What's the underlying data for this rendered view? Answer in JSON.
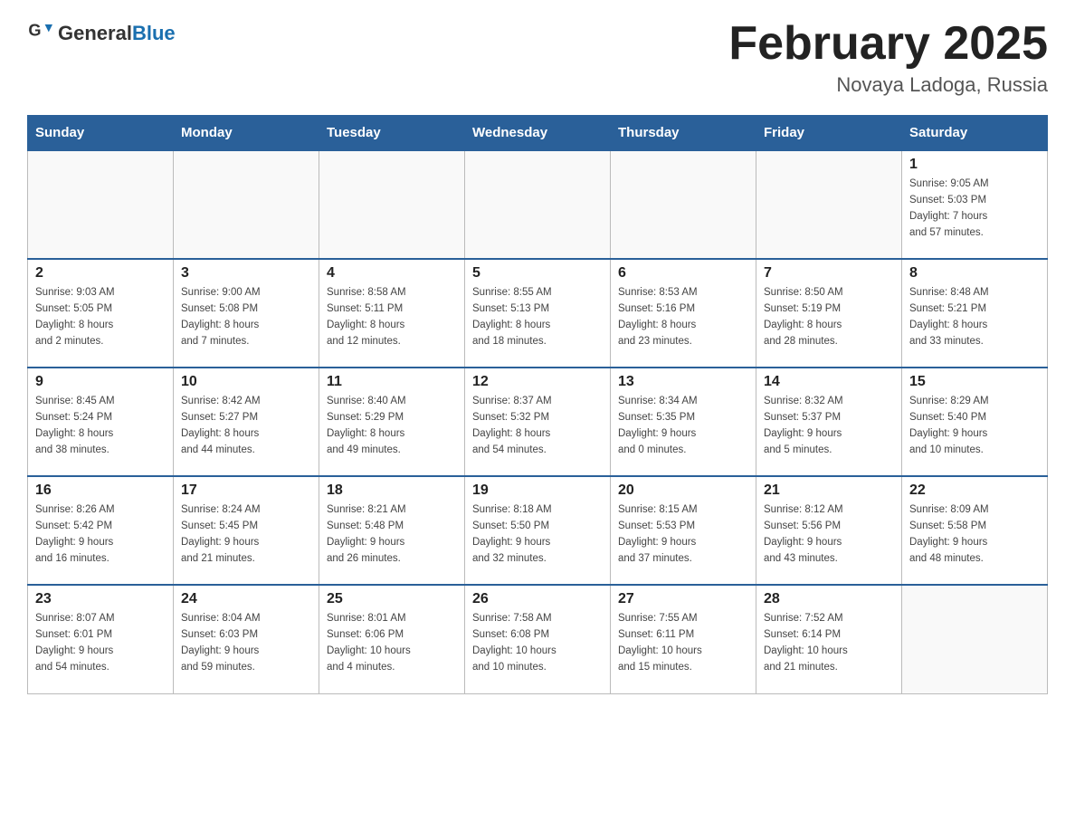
{
  "header": {
    "logo_general": "General",
    "logo_blue": "Blue",
    "month_title": "February 2025",
    "location": "Novaya Ladoga, Russia"
  },
  "days_of_week": [
    "Sunday",
    "Monday",
    "Tuesday",
    "Wednesday",
    "Thursday",
    "Friday",
    "Saturday"
  ],
  "weeks": [
    [
      {
        "day": "",
        "info": ""
      },
      {
        "day": "",
        "info": ""
      },
      {
        "day": "",
        "info": ""
      },
      {
        "day": "",
        "info": ""
      },
      {
        "day": "",
        "info": ""
      },
      {
        "day": "",
        "info": ""
      },
      {
        "day": "1",
        "info": "Sunrise: 9:05 AM\nSunset: 5:03 PM\nDaylight: 7 hours\nand 57 minutes."
      }
    ],
    [
      {
        "day": "2",
        "info": "Sunrise: 9:03 AM\nSunset: 5:05 PM\nDaylight: 8 hours\nand 2 minutes."
      },
      {
        "day": "3",
        "info": "Sunrise: 9:00 AM\nSunset: 5:08 PM\nDaylight: 8 hours\nand 7 minutes."
      },
      {
        "day": "4",
        "info": "Sunrise: 8:58 AM\nSunset: 5:11 PM\nDaylight: 8 hours\nand 12 minutes."
      },
      {
        "day": "5",
        "info": "Sunrise: 8:55 AM\nSunset: 5:13 PM\nDaylight: 8 hours\nand 18 minutes."
      },
      {
        "day": "6",
        "info": "Sunrise: 8:53 AM\nSunset: 5:16 PM\nDaylight: 8 hours\nand 23 minutes."
      },
      {
        "day": "7",
        "info": "Sunrise: 8:50 AM\nSunset: 5:19 PM\nDaylight: 8 hours\nand 28 minutes."
      },
      {
        "day": "8",
        "info": "Sunrise: 8:48 AM\nSunset: 5:21 PM\nDaylight: 8 hours\nand 33 minutes."
      }
    ],
    [
      {
        "day": "9",
        "info": "Sunrise: 8:45 AM\nSunset: 5:24 PM\nDaylight: 8 hours\nand 38 minutes."
      },
      {
        "day": "10",
        "info": "Sunrise: 8:42 AM\nSunset: 5:27 PM\nDaylight: 8 hours\nand 44 minutes."
      },
      {
        "day": "11",
        "info": "Sunrise: 8:40 AM\nSunset: 5:29 PM\nDaylight: 8 hours\nand 49 minutes."
      },
      {
        "day": "12",
        "info": "Sunrise: 8:37 AM\nSunset: 5:32 PM\nDaylight: 8 hours\nand 54 minutes."
      },
      {
        "day": "13",
        "info": "Sunrise: 8:34 AM\nSunset: 5:35 PM\nDaylight: 9 hours\nand 0 minutes."
      },
      {
        "day": "14",
        "info": "Sunrise: 8:32 AM\nSunset: 5:37 PM\nDaylight: 9 hours\nand 5 minutes."
      },
      {
        "day": "15",
        "info": "Sunrise: 8:29 AM\nSunset: 5:40 PM\nDaylight: 9 hours\nand 10 minutes."
      }
    ],
    [
      {
        "day": "16",
        "info": "Sunrise: 8:26 AM\nSunset: 5:42 PM\nDaylight: 9 hours\nand 16 minutes."
      },
      {
        "day": "17",
        "info": "Sunrise: 8:24 AM\nSunset: 5:45 PM\nDaylight: 9 hours\nand 21 minutes."
      },
      {
        "day": "18",
        "info": "Sunrise: 8:21 AM\nSunset: 5:48 PM\nDaylight: 9 hours\nand 26 minutes."
      },
      {
        "day": "19",
        "info": "Sunrise: 8:18 AM\nSunset: 5:50 PM\nDaylight: 9 hours\nand 32 minutes."
      },
      {
        "day": "20",
        "info": "Sunrise: 8:15 AM\nSunset: 5:53 PM\nDaylight: 9 hours\nand 37 minutes."
      },
      {
        "day": "21",
        "info": "Sunrise: 8:12 AM\nSunset: 5:56 PM\nDaylight: 9 hours\nand 43 minutes."
      },
      {
        "day": "22",
        "info": "Sunrise: 8:09 AM\nSunset: 5:58 PM\nDaylight: 9 hours\nand 48 minutes."
      }
    ],
    [
      {
        "day": "23",
        "info": "Sunrise: 8:07 AM\nSunset: 6:01 PM\nDaylight: 9 hours\nand 54 minutes."
      },
      {
        "day": "24",
        "info": "Sunrise: 8:04 AM\nSunset: 6:03 PM\nDaylight: 9 hours\nand 59 minutes."
      },
      {
        "day": "25",
        "info": "Sunrise: 8:01 AM\nSunset: 6:06 PM\nDaylight: 10 hours\nand 4 minutes."
      },
      {
        "day": "26",
        "info": "Sunrise: 7:58 AM\nSunset: 6:08 PM\nDaylight: 10 hours\nand 10 minutes."
      },
      {
        "day": "27",
        "info": "Sunrise: 7:55 AM\nSunset: 6:11 PM\nDaylight: 10 hours\nand 15 minutes."
      },
      {
        "day": "28",
        "info": "Sunrise: 7:52 AM\nSunset: 6:14 PM\nDaylight: 10 hours\nand 21 minutes."
      },
      {
        "day": "",
        "info": ""
      }
    ]
  ]
}
